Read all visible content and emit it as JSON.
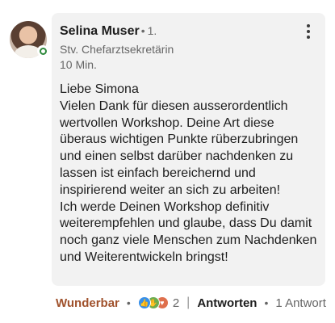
{
  "comment": {
    "author": "Selina Muser",
    "degree": "1.",
    "headline": "Stv. Chefarztsekretärin",
    "timestamp": "10 Min.",
    "body": "Liebe Simona\nVielen Dank für diesen ausserordentlich wertvollen Workshop. Deine Art diese überaus wichtigen Punkte rüberzubringen und einen selbst darüber nachdenken zu lassen ist einfach bereichernd und inspirierend weiter an sich zu arbeiten!\nIch werde Deinen Workshop definitiv weiterempfehlen und glaube, dass Du damit noch ganz viele Menschen zum Nachdenken und Weiterentwickeln bringst!"
  },
  "actions": {
    "reaction_label": "Wunderbar",
    "separator": "•",
    "reaction_count": "2",
    "divider": "|",
    "reply_label": "Antworten",
    "reply_count": "1 Antwort",
    "reaction_icons": [
      "like-icon",
      "celebrate-icon",
      "love-icon"
    ]
  },
  "colors": {
    "accent_reaction": "#a0522d",
    "bubble_bg": "#f2f2f2",
    "online_status": "#2f8a3d"
  }
}
